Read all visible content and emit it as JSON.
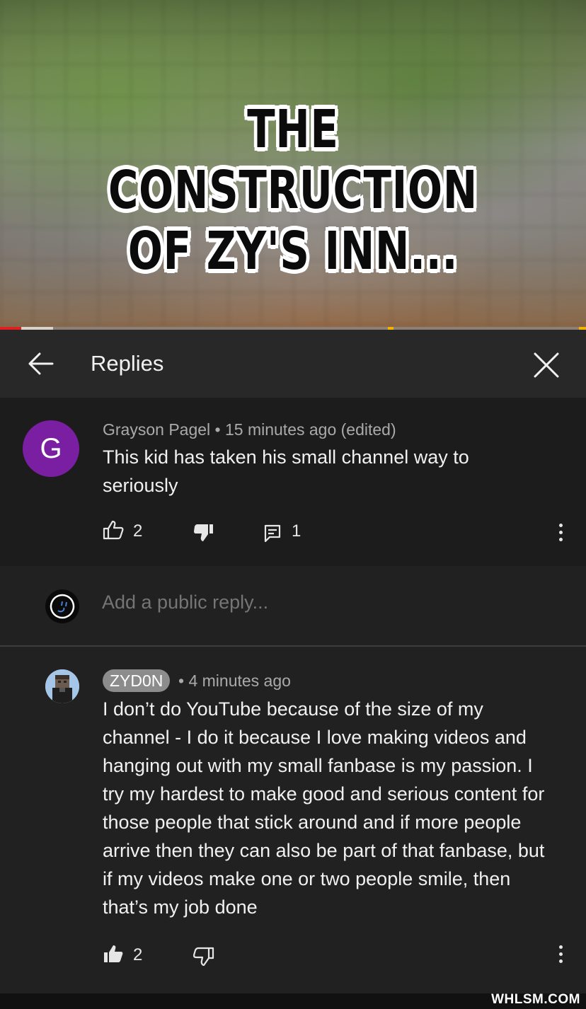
{
  "video": {
    "title_line1": "THE CONSTRUCTION",
    "title_line2": "OF ZY'S INN..."
  },
  "header": {
    "title": "Replies",
    "back_icon": "arrow-left-icon",
    "close_icon": "close-icon"
  },
  "parent_comment": {
    "avatar_letter": "G",
    "avatar_color": "#7b1fa2",
    "author": "Grayson Pagel",
    "separator": "•",
    "time": "15 minutes ago (edited)",
    "text_line1": "This kid has taken his small channel way to",
    "text_line2": "seriously",
    "likes": "2",
    "replies": "1"
  },
  "reply_box": {
    "placeholder": "Add a public reply..."
  },
  "reply": {
    "author": "ZYD0N",
    "separator": "•",
    "time": "4 minutes ago",
    "lines": [
      "I don’t do YouTube because of the size of my",
      "channel - I do it because I love making videos and",
      "hanging out with my small fanbase is my passion. I",
      "try my hardest to make good and serious content for",
      "those people that stick around and if more people",
      "arrive then they can also be part of that fanbase, but",
      "if my videos make one or two people smile, then",
      "that’s my job done"
    ],
    "likes": "2"
  },
  "watermark": "WHLSM.COM",
  "colors": {
    "background": "#212121",
    "parent_bg": "#1c1c1c",
    "header_bg": "#282828",
    "progress_played": "#e02020"
  }
}
